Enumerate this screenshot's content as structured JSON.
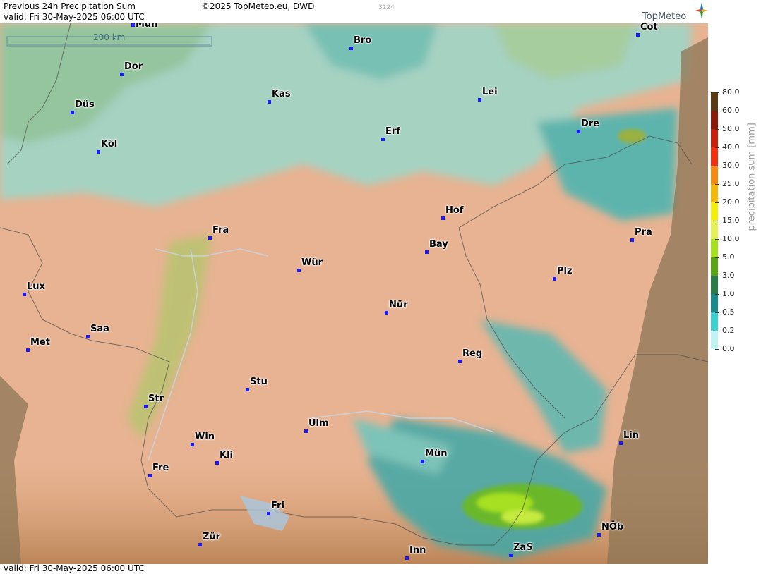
{
  "header": {
    "title": "Previous 24h Precipitation Sum",
    "copyright": "©2025 TopMeteo.eu, DWD",
    "code": "3124",
    "valid": "valid:  Fri  30-May-2025 06:00 UTC",
    "brand": "TopMeteo"
  },
  "footer": {
    "valid": "valid:  Fri  30-May-2025 06:00 UTC"
  },
  "map": {
    "scale_label": "200 km",
    "cities": [
      {
        "name": "Mün",
        "top": true
      },
      {
        "name": "Bro"
      },
      {
        "name": "Cot"
      },
      {
        "name": "Dor"
      },
      {
        "name": "Kas"
      },
      {
        "name": "Lei"
      },
      {
        "name": "Düs"
      },
      {
        "name": "Dre"
      },
      {
        "name": "Erf"
      },
      {
        "name": "Köl"
      },
      {
        "name": "Hof"
      },
      {
        "name": "Fra"
      },
      {
        "name": "Pra"
      },
      {
        "name": "Bay"
      },
      {
        "name": "Wür"
      },
      {
        "name": "Plz"
      },
      {
        "name": "Lux"
      },
      {
        "name": "Nür"
      },
      {
        "name": "Saa"
      },
      {
        "name": "Met"
      },
      {
        "name": "Reg"
      },
      {
        "name": "Stu"
      },
      {
        "name": "Str"
      },
      {
        "name": "Ulm"
      },
      {
        "name": "Lin"
      },
      {
        "name": "Win"
      },
      {
        "name": "Mün"
      },
      {
        "name": "Kli"
      },
      {
        "name": "Fre"
      },
      {
        "name": "Fri"
      },
      {
        "name": "NÖb"
      },
      {
        "name": "Zür"
      },
      {
        "name": "ZaS"
      },
      {
        "name": "Inn"
      }
    ]
  },
  "legend": {
    "title": "precipitation sum  [mm]",
    "entries": [
      {
        "label": "80.0",
        "color": "#5a3a12"
      },
      {
        "label": "60.0",
        "color": "#8b1a0a"
      },
      {
        "label": "50.0",
        "color": "#c81e0e"
      },
      {
        "label": "40.0",
        "color": "#f03010"
      },
      {
        "label": "30.0",
        "color": "#f58a12"
      },
      {
        "label": "25.0",
        "color": "#f2b80e"
      },
      {
        "label": "20.0",
        "color": "#f2ee10"
      },
      {
        "label": "15.0",
        "color": "#e6f05a"
      },
      {
        "label": "10.0",
        "color": "#a6e020"
      },
      {
        "label": "5.0",
        "color": "#5aa418"
      },
      {
        "label": "3.0",
        "color": "#2a7a4a"
      },
      {
        "label": "1.0",
        "color": "#1a8a8a"
      },
      {
        "label": "0.5",
        "color": "#3ed0d0"
      },
      {
        "label": "0.2",
        "color": "#bff4f2"
      },
      {
        "label": "0.0",
        "color": "#ffffff"
      }
    ]
  }
}
